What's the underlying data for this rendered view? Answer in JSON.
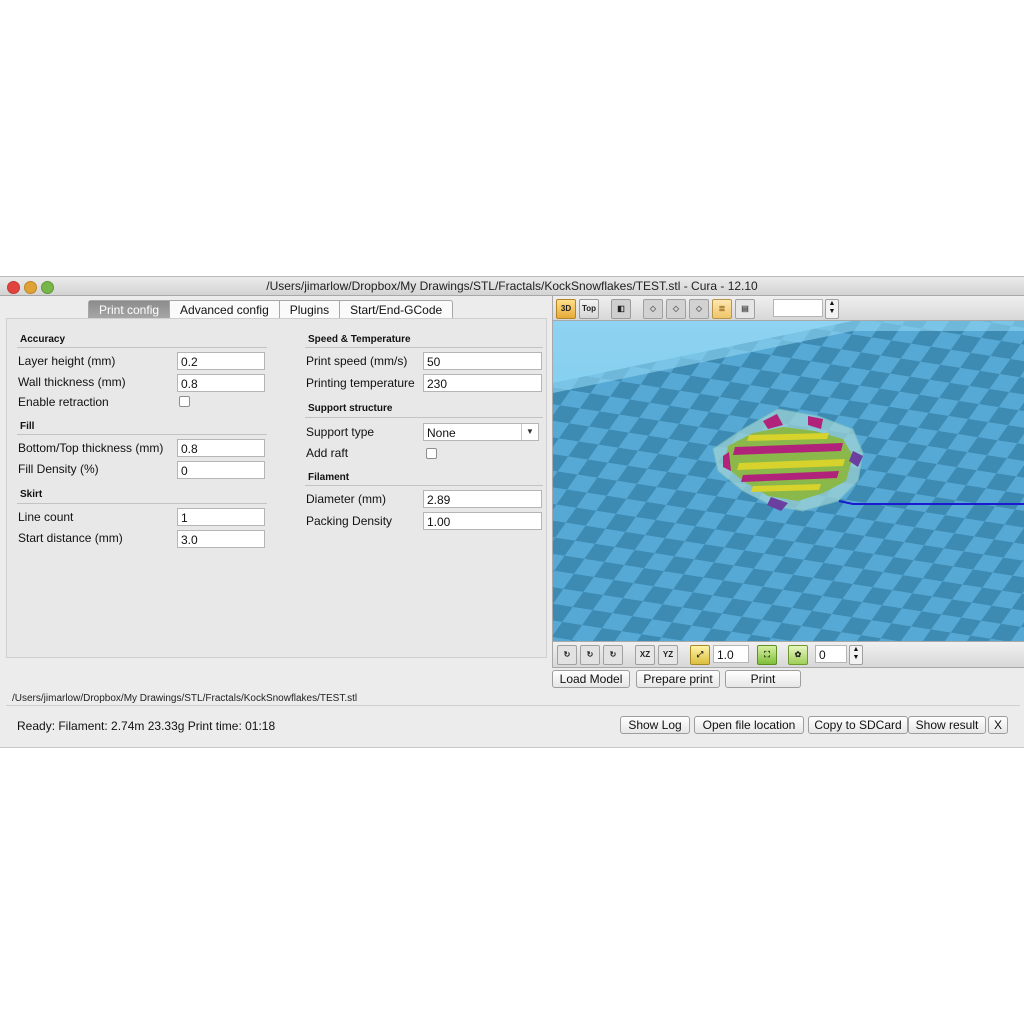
{
  "window": {
    "title": "/Users/jimarlow/Dropbox/My Drawings/STL/Fractals/KockSnowflakes/TEST.stl - Cura - 12.10"
  },
  "tabs": [
    {
      "label": "Print config"
    },
    {
      "label": "Advanced config"
    },
    {
      "label": "Plugins"
    },
    {
      "label": "Start/End-GCode"
    }
  ],
  "left": {
    "accuracy": {
      "title": "Accuracy",
      "layer_height_label": "Layer height (mm)",
      "layer_height": "0.2",
      "wall_thickness_label": "Wall thickness (mm)",
      "wall_thickness": "0.8",
      "retraction_label": "Enable retraction"
    },
    "fill": {
      "title": "Fill",
      "bottom_top_label": "Bottom/Top thickness (mm)",
      "bottom_top": "0.8",
      "density_label": "Fill Density (%)",
      "density": "0"
    },
    "skirt": {
      "title": "Skirt",
      "line_count_label": "Line count",
      "line_count": "1",
      "start_distance_label": "Start distance (mm)",
      "start_distance": "3.0"
    }
  },
  "right": {
    "speed": {
      "title": "Speed & Temperature",
      "print_speed_label": "Print speed (mm/s)",
      "print_speed": "50",
      "temp_label": "Printing temperature",
      "temp": "230"
    },
    "support": {
      "title": "Support structure",
      "type_label": "Support type",
      "type": "None",
      "raft_label": "Add raft"
    },
    "filament": {
      "title": "Filament",
      "diameter_label": "Diameter (mm)",
      "diameter": "2.89",
      "packing_label": "Packing Density",
      "packing": "1.00"
    }
  },
  "viewport": {
    "top_toolbar": {
      "btn_3d": "3D",
      "btn_top": "Top",
      "layer_value": ""
    },
    "bottom_toolbar": {
      "scale_value": "1.0",
      "rotate_value": "0",
      "xz": "XZ",
      "yz": "YZ"
    }
  },
  "actions": {
    "load": "Load Model",
    "prepare": "Prepare print",
    "print": "Print"
  },
  "file_path": "/Users/jimarlow/Dropbox/My Drawings/STL/Fractals/KockSnowflakes/TEST.stl",
  "status": {
    "text": "Ready: Filament: 2.74m 23.33g Print time: 01:18",
    "show_log": "Show Log",
    "open_location": "Open file location",
    "copy_sd": "Copy to SDCard",
    "show_result": "Show result",
    "close": "X"
  },
  "colors": {
    "viewport_bg": "#5ab2dc",
    "grid_dark": "#3d8ab3",
    "grid_light": "#56a9d5",
    "travel_line": "#1a1ad0"
  }
}
